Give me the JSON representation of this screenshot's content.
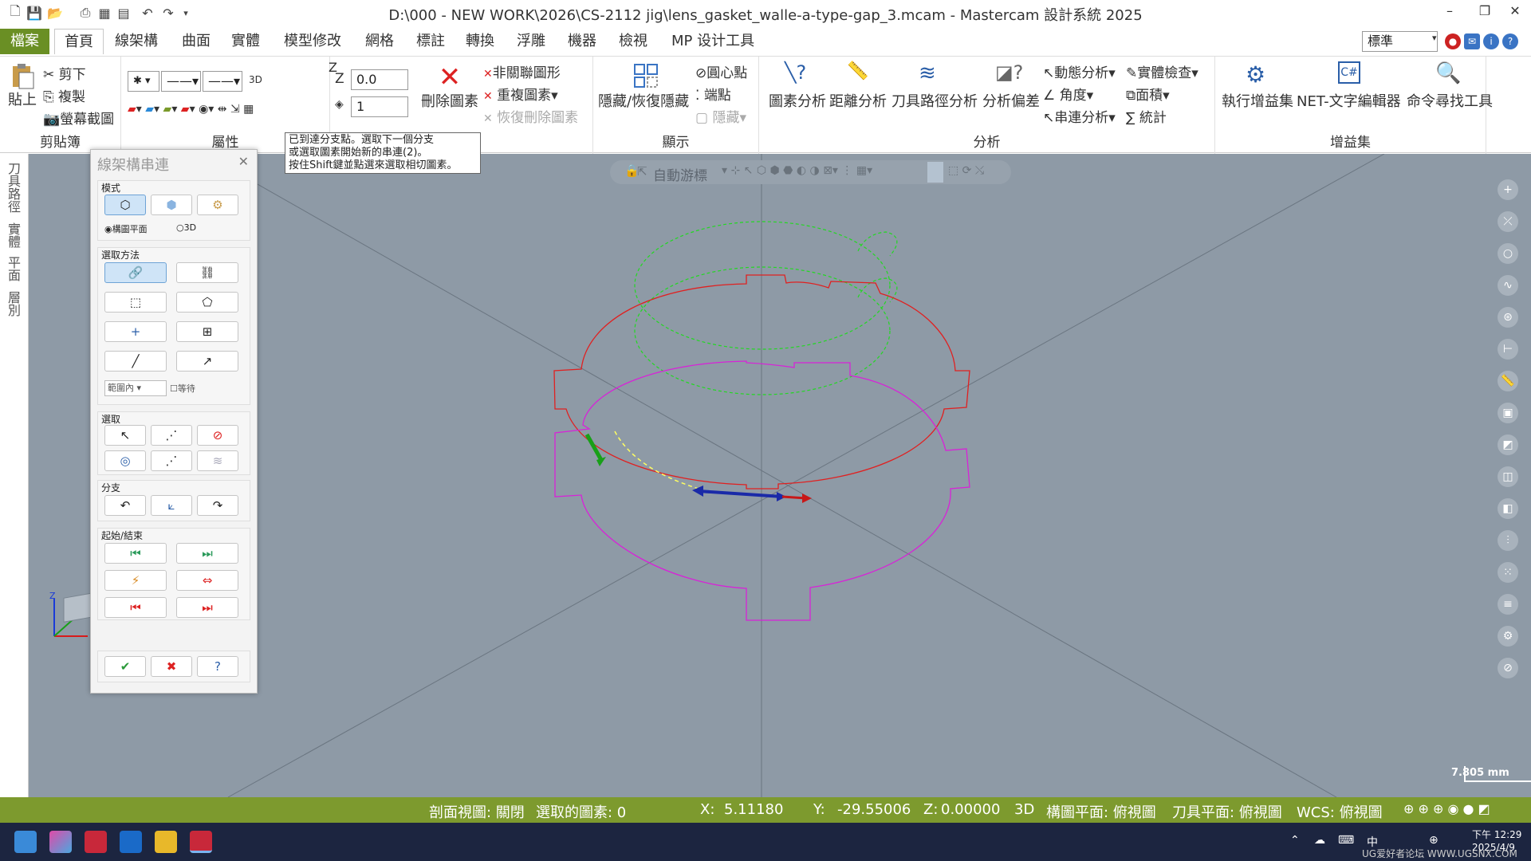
{
  "window": {
    "title": "D:\\000 - NEW WORK\\2026\\CS-2112 jig\\lens_gasket_walle-a-type-gap_3.mcam - Mastercam 設計系統 2025"
  },
  "menu": {
    "file": "檔案",
    "tabs": [
      "首頁",
      "線架構",
      "曲面",
      "實體",
      "模型修改",
      "網格",
      "標註",
      "轉換",
      "浮雕",
      "機器",
      "檢視",
      "MP 设计工具"
    ],
    "style_combo": "標準"
  },
  "ribbon": {
    "clipboard": {
      "paste": "貼上",
      "cut": "剪下",
      "copy": "複製",
      "screenshot": "螢幕截圖",
      "label": "剪貼簿"
    },
    "attributes": {
      "label": "屬性",
      "mode_3d": "3D",
      "z_label": "Z",
      "z_value": "0.0",
      "level_value": "1"
    },
    "delete": {
      "delete_entities": "刪除圖素",
      "unrelated": "非關聯圖形",
      "duplicate": "重複圖素",
      "undelete": "恢復刪除圖素",
      "label": "刪除"
    },
    "display": {
      "hide_unhide": "隱藏/恢復隱藏",
      "center_point": "圓心點",
      "endpoints": "端點",
      "hide": "隱藏",
      "label": "顯示"
    },
    "analyze": {
      "entity": "圖素分析",
      "distance": "距離分析",
      "toolpath": "刀具路徑分析",
      "deviation": "分析偏差",
      "dynamic": "動態分析",
      "angle": "角度",
      "chain": "串連分析",
      "solid_check": "實體檢查",
      "area": "面積",
      "stats": "統計",
      "label": "分析"
    },
    "addins": {
      "run": "執行增益集",
      "net_editor": "NET-文字編輯器",
      "finder": "命令尋找工具",
      "label": "增益集"
    }
  },
  "tooltip": {
    "line1": "已到達分支點。選取下一個分支",
    "line2": "或選取圖素開始新的串連(2)。",
    "line3": "按住Shift鍵並點選來選取相切圖素。"
  },
  "left_tabs": [
    "刀具路徑",
    "實體",
    "平面",
    "層別"
  ],
  "viewport": {
    "auto_cursor": "自動游標",
    "scale_label": "7.805 mm",
    "colors": {
      "bg": "#8e9aa6",
      "red": "#e02020",
      "magenta": "#d822d8",
      "green": "#22d822"
    }
  },
  "dialog": {
    "title": "線架構串連",
    "mode_label": "模式",
    "radio_plane": "構圖平面",
    "radio_3d": "3D",
    "method_label": "選取方法",
    "range_combo": "範圍內",
    "wait_label": "等待",
    "select_label": "選取",
    "branch_label": "分支",
    "startend_label": "起始/結束"
  },
  "status": {
    "section_view": "剖面視圖: 關閉",
    "selected": "選取的圖素: 0",
    "x_label": "X:",
    "x_value": "5.11180",
    "y_label": "Y:",
    "y_value": "-29.55006",
    "z_label": "Z:",
    "z_value": "0.00000",
    "mode": "3D",
    "cplane": "構圖平面: 俯視圖",
    "tplane": "刀具平面: 俯視圖",
    "wcs": "WCS: 俯視圖"
  },
  "taskbar": {
    "time": "下午 12:29",
    "date": "2025/4/9",
    "ime": "中",
    "watermark": "UG爱好者论坛 WWW.UGSNX.COM"
  }
}
